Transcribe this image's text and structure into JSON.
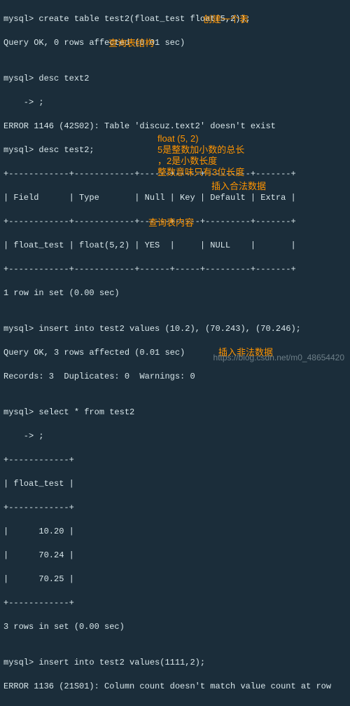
{
  "lines": {
    "l1": "mysql> create table test2(float_test float(5,2));",
    "l2": "Query OK, 0 rows affected (0.01 sec)",
    "l3": "",
    "l4": "mysql> desc text2",
    "l5": "    -> ;",
    "l6": "ERROR 1146 (42S02): Table 'discuz.text2' doesn't exist",
    "l7": "mysql> desc test2;",
    "l8": "+------------+------------+------+-----+---------+-------+",
    "l9": "| Field      | Type       | Null | Key | Default | Extra |",
    "l10": "+------------+------------+------+-----+---------+-------+",
    "l11": "| float_test | float(5,2) | YES  |     | NULL    |       |",
    "l12": "+------------+------------+------+-----+---------+-------+",
    "l13": "1 row in set (0.00 sec)",
    "l14": "",
    "l15": "mysql> insert into test2 values (10.2), (70.243), (70.246);",
    "l16": "Query OK, 3 rows affected (0.01 sec)",
    "l17": "Records: 3  Duplicates: 0  Warnings: 0",
    "l18": "",
    "l19": "mysql> select * from test2",
    "l20": "    -> ;",
    "l21": "+------------+",
    "l22": "| float_test |",
    "l23": "+------------+",
    "l24": "|      10.20 |",
    "l25": "|      70.24 |",
    "l26": "|      70.25 |",
    "l27": "+------------+",
    "l28": "3 rows in set (0.00 sec)",
    "l29": "",
    "l30": "mysql> insert into test2 values(1111,2);",
    "l31": "ERROR 1136 (21S01): Column count doesn't match value count at row "
  },
  "ann": {
    "a1": "创建一个表",
    "a2": "查询表结构",
    "a3": "float (5, 2)",
    "a4": "5是整数加小数的总长",
    "a5": "，2是小数长度",
    "a6": "整数意味只有3位长度",
    "a7": "插入合法数据",
    "a8": "查询表内容",
    "a9": "插入非法数据"
  },
  "watermark": "https://blog.csdn.net/m0_48654420"
}
